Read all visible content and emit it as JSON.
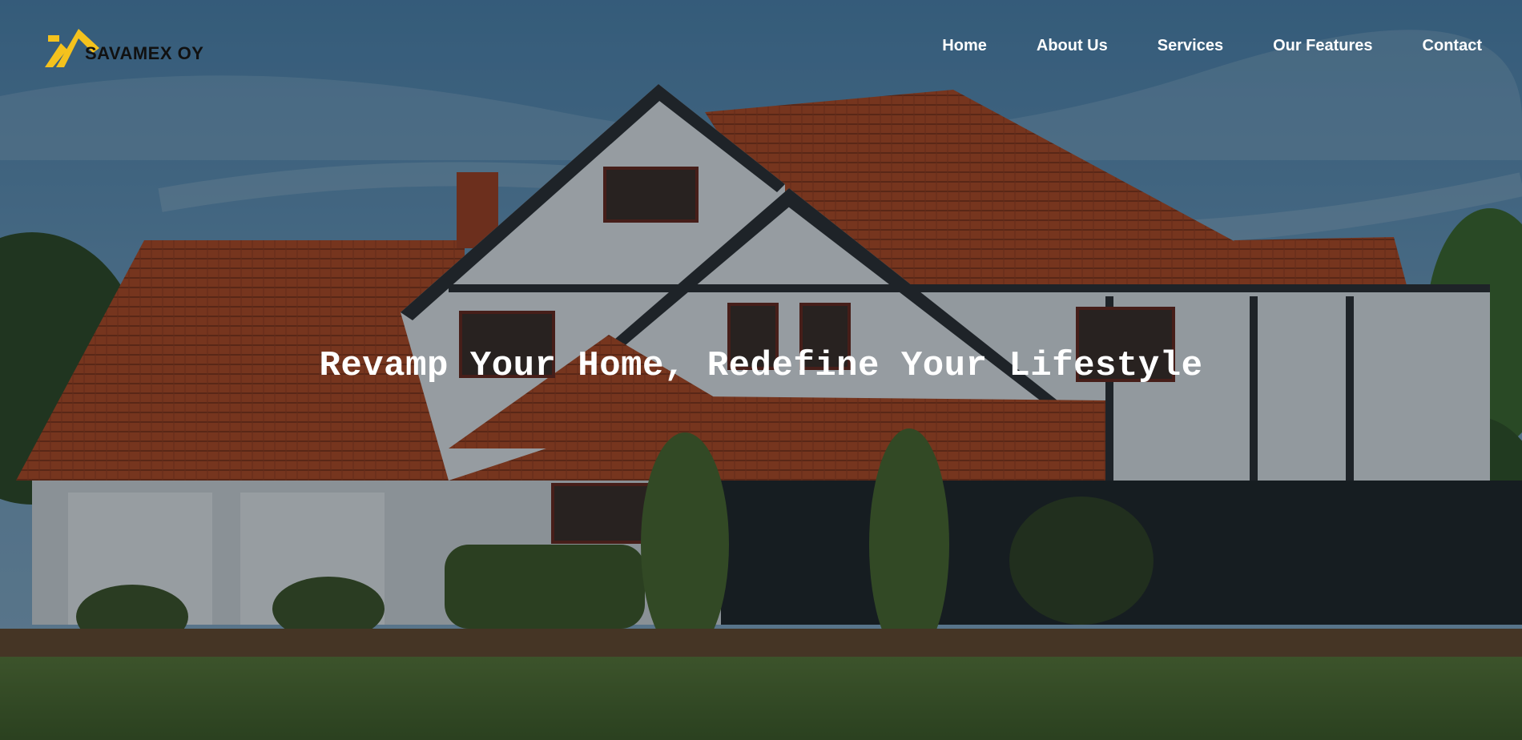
{
  "brand": {
    "name": "SAVAMEX OY",
    "logo_color": "#f4c21d",
    "logo_icon": "roof-chevron-logo"
  },
  "nav": {
    "items": [
      {
        "label": "Home"
      },
      {
        "label": "About Us"
      },
      {
        "label": "Services"
      },
      {
        "label": "Our Features"
      },
      {
        "label": "Contact"
      }
    ]
  },
  "hero": {
    "headline": "Revamp Your Home, Redefine Your Lifestyle",
    "background": "photo of a tudor-style house with red tiled roof under blue sky"
  },
  "colors": {
    "sky": "#5d8fb6",
    "roof": "#b5471e",
    "wall": "#e9edf0",
    "timber": "#2a2d30",
    "grass": "#4c6d2c",
    "overlay": "rgba(10,20,30,0.38)"
  }
}
